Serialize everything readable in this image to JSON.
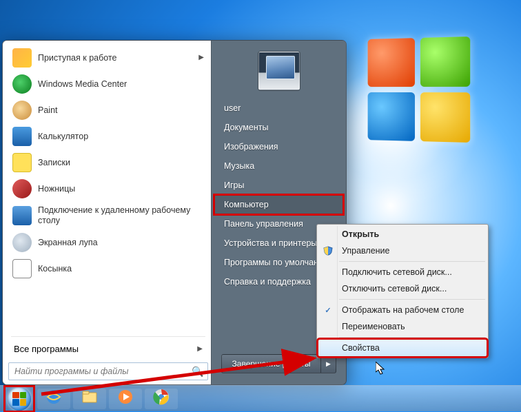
{
  "start_menu": {
    "programs": [
      {
        "label": "Приступая к работе",
        "icon": "getting-started",
        "has_submenu": true
      },
      {
        "label": "Windows Media Center",
        "icon": "media-center"
      },
      {
        "label": "Paint",
        "icon": "paint"
      },
      {
        "label": "Калькулятор",
        "icon": "calculator"
      },
      {
        "label": "Записки",
        "icon": "sticky-notes"
      },
      {
        "label": "Ножницы",
        "icon": "snipping-tool"
      },
      {
        "label": "Подключение к удаленному рабочему столу",
        "icon": "remote-desktop"
      },
      {
        "label": "Экранная лупа",
        "icon": "magnifier"
      },
      {
        "label": "Косынка",
        "icon": "solitaire"
      }
    ],
    "all_programs_label": "Все программы",
    "search_placeholder": "Найти программы и файлы",
    "right_items": [
      "user",
      "Документы",
      "Изображения",
      "Музыка",
      "Игры",
      "Компьютер",
      "Панель управления",
      "Устройства и принтеры",
      "Программы по умолчанию",
      "Справка и поддержка"
    ],
    "selected_right_item": "Компьютер",
    "shutdown_label": "Завершение работы"
  },
  "context_menu": {
    "items": [
      {
        "label": "Открыть",
        "bold": true
      },
      {
        "label": "Управление",
        "icon": "shield"
      },
      {
        "sep": true
      },
      {
        "label": "Подключить сетевой диск..."
      },
      {
        "label": "Отключить сетевой диск..."
      },
      {
        "sep": true
      },
      {
        "label": "Отображать на рабочем столе",
        "check": true
      },
      {
        "label": "Переименовать"
      },
      {
        "sep": true
      },
      {
        "label": "Свойства",
        "selected": true
      }
    ]
  },
  "taskbar": {
    "items": [
      {
        "name": "internet-explorer"
      },
      {
        "name": "file-explorer"
      },
      {
        "name": "media-player"
      },
      {
        "name": "chrome"
      }
    ]
  }
}
